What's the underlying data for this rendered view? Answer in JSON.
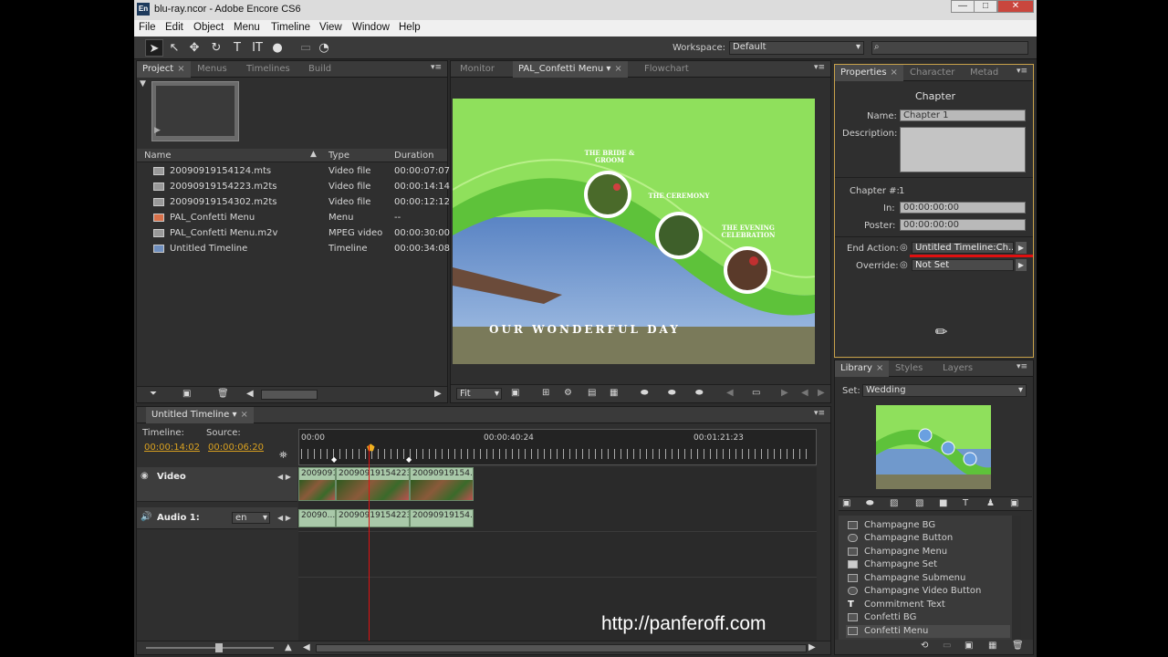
{
  "window": {
    "title": "blu-ray.ncor - Adobe Encore CS6",
    "app_icon": "En",
    "min": "—",
    "max": "□",
    "close": "✕"
  },
  "menubar": [
    "File",
    "Edit",
    "Object",
    "Menu",
    "Timeline",
    "View",
    "Window",
    "Help"
  ],
  "toolbar": {
    "workspace_label": "Workspace:",
    "workspace_value": "Default",
    "search_placeholder": ""
  },
  "project_panel": {
    "tabs": [
      "Project",
      "Menus",
      "Timelines",
      "Build"
    ],
    "columns": [
      "Name",
      "Type",
      "Duration"
    ],
    "rows": [
      {
        "name": "20090919154124.mts",
        "type": "Video file",
        "duration": "00:00:07:07"
      },
      {
        "name": "20090919154223.m2ts",
        "type": "Video file",
        "duration": "00:00:14:14"
      },
      {
        "name": "20090919154302.m2ts",
        "type": "Video file",
        "duration": "00:00:12:12"
      },
      {
        "name": "PAL_Confetti Menu",
        "type": "Menu",
        "duration": "--"
      },
      {
        "name": "PAL_Confetti Menu.m2v",
        "type": "MPEG video",
        "duration": "00:00:30:00"
      },
      {
        "name": "Untitled Timeline",
        "type": "Timeline",
        "duration": "00:00:34:08"
      }
    ]
  },
  "monitor_panel": {
    "tabs": [
      "Monitor",
      "PAL_Confetti Menu",
      "Flowchart"
    ],
    "menu_texts": [
      "THE BRIDE & GROOM",
      "THE CEREMONY",
      "THE EVENING CELEBRATION"
    ],
    "menu_title": "OUR WONDERFUL DAY",
    "zoom": "Fit",
    "colors": {
      "bg_green": "#8fe05c",
      "wave": "#5ec23a",
      "sky": "#6b93c8"
    }
  },
  "properties_panel": {
    "tabs": [
      "Properties",
      "Character",
      "Metad"
    ],
    "heading": "Chapter",
    "name_label": "Name:",
    "name_value": "Chapter 1",
    "description_label": "Description:",
    "chapter_num_label": "Chapter #:",
    "chapter_num_value": "1",
    "in_label": "In:",
    "in_value": "00:00:00:00",
    "poster_label": "Poster:",
    "poster_value": "00:00:00:00",
    "end_action_label": "End Action:",
    "end_action_value": "Untitled Timeline:Ch...",
    "override_label": "Override:",
    "override_value": "Not Set"
  },
  "library_panel": {
    "tabs": [
      "Library",
      "Styles",
      "Layers"
    ],
    "set_label": "Set:",
    "set_value": "Wedding",
    "items": [
      "Champagne BG",
      "Champagne Button",
      "Champagne Menu",
      "Champagne Set",
      "Champagne Submenu",
      "Champagne Video Button",
      "Commitment Text",
      "Confetti BG",
      "Confetti Menu"
    ]
  },
  "timeline_panel": {
    "tab": "Untitled Timeline",
    "timeline_label": "Timeline:",
    "timeline_time": "00:00:14:02",
    "source_label": "Source:",
    "source_time": "00:00:06:20",
    "ruler": [
      "00:00",
      "00:00:40:24",
      "00:01:21:23"
    ],
    "video_track": "Video",
    "audio_track": "Audio 1:",
    "audio_lang": "en",
    "video_clips": [
      "20090919154...",
      "20090919154223...",
      "20090919154..."
    ],
    "audio_clips": [
      "20090...",
      "20090919154223...",
      "20090919154..."
    ]
  },
  "watermark": "http://panferoff.com"
}
